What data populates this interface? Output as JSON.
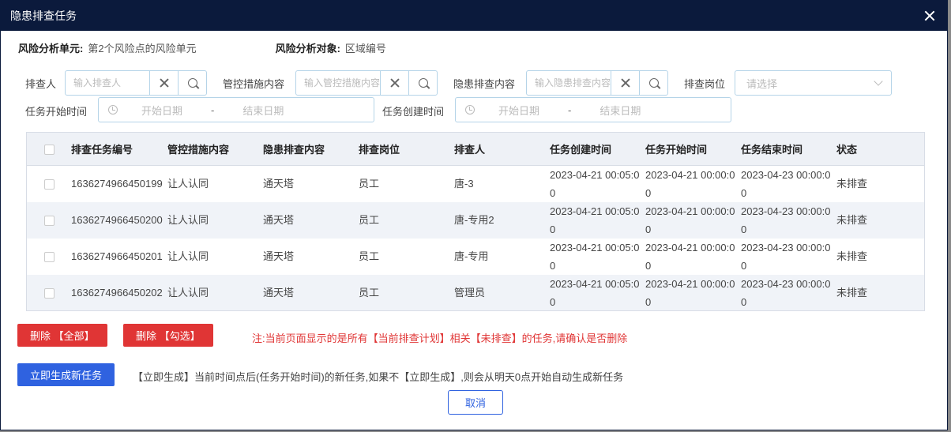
{
  "dialog": {
    "title": "隐患排查任务"
  },
  "info": {
    "unit_label": "风险分析单元:",
    "unit_value": "第2个风险点的风险单元",
    "object_label": "风险分析对象:",
    "object_value": "区域编号"
  },
  "filters": {
    "inspector": {
      "label": "排查人",
      "placeholder": "输入排查人"
    },
    "control": {
      "label": "管控措施内容",
      "placeholder": "输入管控措施内容"
    },
    "hazard": {
      "label": "隐患排查内容",
      "placeholder": "输入隐患排查内容"
    },
    "post": {
      "label": "排查岗位",
      "placeholder": "请选择"
    },
    "start_time": {
      "label": "任务开始时间",
      "from": "开始日期",
      "to": "结束日期",
      "sep": "-"
    },
    "create_time": {
      "label": "任务创建时间",
      "from": "开始日期",
      "to": "结束日期",
      "sep": "-"
    }
  },
  "table": {
    "headers": [
      "排查任务编号",
      "管控措施内容",
      "隐患排查内容",
      "排查岗位",
      "排查人",
      "任务创建时间",
      "任务开始时间",
      "任务结束时间",
      "状态"
    ],
    "rows": [
      [
        "1636274966450199",
        "让人认同",
        "通天塔",
        "员工",
        "唐-3",
        "2023-04-21 00:05:00",
        "2023-04-21 00:00:00",
        "2023-04-23 00:00:00",
        "未排查"
      ],
      [
        "1636274966450200",
        "让人认同",
        "通天塔",
        "员工",
        "唐-专用2",
        "2023-04-21 00:05:00",
        "2023-04-21 00:00:00",
        "2023-04-23 00:00:00",
        "未排查"
      ],
      [
        "1636274966450201",
        "让人认同",
        "通天塔",
        "员工",
        "唐-专用",
        "2023-04-21 00:05:00",
        "2023-04-21 00:00:00",
        "2023-04-23 00:00:00",
        "未排查"
      ],
      [
        "1636274966450202",
        "让人认同",
        "通天塔",
        "员工",
        "管理员",
        "2023-04-21 00:05:00",
        "2023-04-21 00:00:00",
        "2023-04-23 00:00:00",
        "未排查"
      ]
    ]
  },
  "actions": {
    "delete_all": "删除 【全部】",
    "delete_selected": "删除 【勾选】",
    "delete_note": "注:当前页面显示的是所有【当前排查计划】相关【未排查】的任务,请确认是否删除",
    "generate": "立即生成新任务",
    "generate_note": "【立即生成】当前时间点后(任务开始时间)的新任务,如果不【立即生成】,则会从明天0点开始自动生成新任务",
    "cancel": "取消"
  },
  "icons": {
    "close": "close-icon",
    "clear": "clear-icon",
    "search": "search-icon",
    "clock": "clock-icon",
    "chevron": "chevron-down-icon"
  },
  "colors": {
    "titlebar": "#0b1a3c",
    "danger": "#e03535",
    "primary": "#2f62e0"
  }
}
